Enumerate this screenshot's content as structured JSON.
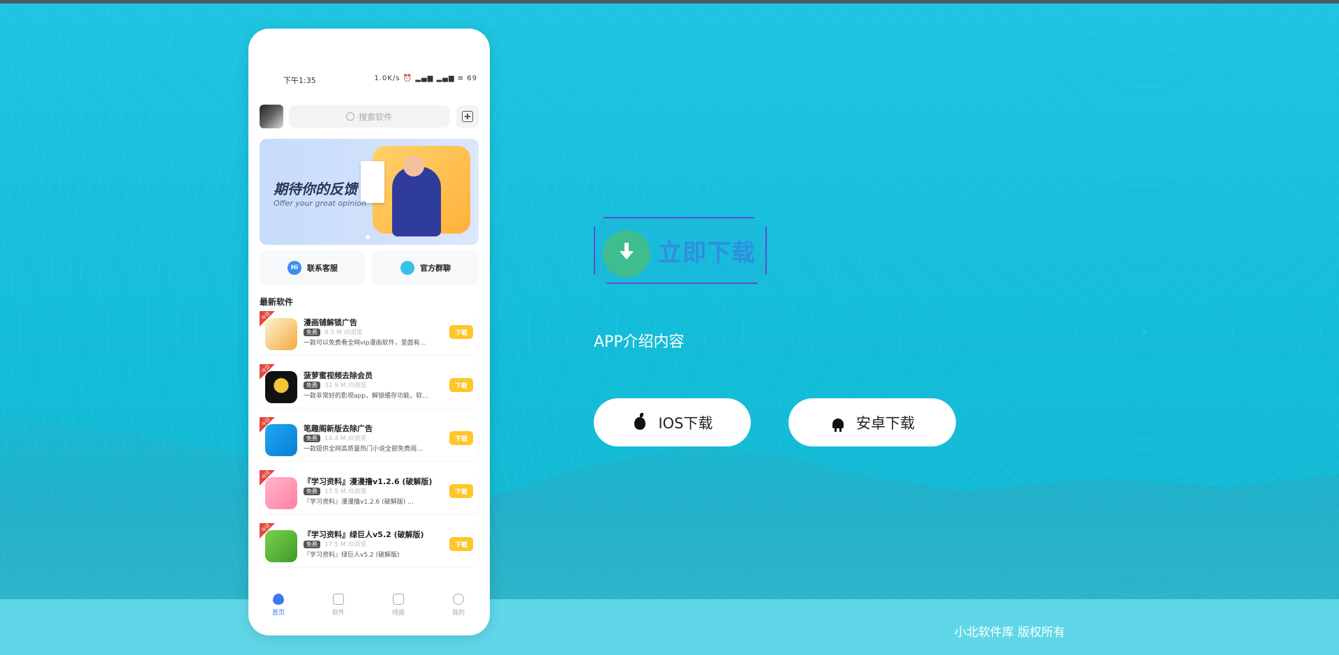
{
  "colors": {
    "page_bg": "#1ac6de",
    "cta_text": "#2f8ee0",
    "cta_circle": "#3fbd8f",
    "download_badge": "#ffc629",
    "active_tab": "#3a7af0"
  },
  "phone": {
    "status_time": "下午1:35",
    "status_icons": "1.0K/s ⏰ ▂▄▆ ▂▄▆ ≋ 69",
    "search_placeholder": "搜索软件",
    "banner": {
      "title": "期待你的反馈",
      "subtitle": "Offer your great opinion"
    },
    "quick_links": [
      {
        "label": "联系客服",
        "icon": "hi-bubble-icon"
      },
      {
        "label": "官方群聊",
        "icon": "chat-bubbles-icon"
      }
    ],
    "section_title": "最新软件",
    "apps": [
      {
        "tag": "今日",
        "name": "漫画铺解锁广告",
        "free": "免费",
        "meta": "9.5 M /0浏览",
        "desc": "一款可以免费看全网vip漫画软件，里面有…",
        "download": "下载",
        "icon": "manga-app-icon"
      },
      {
        "tag": "今日",
        "name": "菠萝蜜视频去除会员",
        "free": "免费",
        "meta": "32.9 M /0浏览",
        "desc": "一款非常好的影视app，解锁缓存功能，软…",
        "download": "下载",
        "icon": "pineapple-app-icon"
      },
      {
        "tag": "今日",
        "name": "笔趣阁新版去除广告",
        "free": "免费",
        "meta": "14.4 M /0浏览",
        "desc": "一款提供全网高质量热门小说全部免费阅…",
        "download": "下载",
        "icon": "biquge-app-icon"
      },
      {
        "tag": "今日",
        "name": "『学习资料』漫漫撸v1.2.6 (破解版)",
        "free": "免费",
        "meta": "17.5 M /0浏览",
        "desc": "『学习资料』漫漫撸v1.2.6 (破解版) …",
        "download": "下载",
        "icon": "mmlu-app-icon"
      },
      {
        "tag": "今日",
        "name": "『学习资料』绿巨人v5.2 (破解版)",
        "free": "免费",
        "meta": "17.5 M /0浏览",
        "desc": "『学习资料』绿巨人v5.2 (破解版)",
        "download": "下载",
        "icon": "hulk-app-icon"
      }
    ],
    "tabs": [
      {
        "label": "首页",
        "active": true
      },
      {
        "label": "软件",
        "active": false
      },
      {
        "label": "线报",
        "active": false
      },
      {
        "label": "我的",
        "active": false
      }
    ]
  },
  "cta": {
    "label": "立即下载"
  },
  "intro": "APP介绍内容",
  "buttons": {
    "ios": "IOS下载",
    "android": "安卓下载"
  },
  "footer": {
    "copyright": "小北软件库 版权所有"
  }
}
